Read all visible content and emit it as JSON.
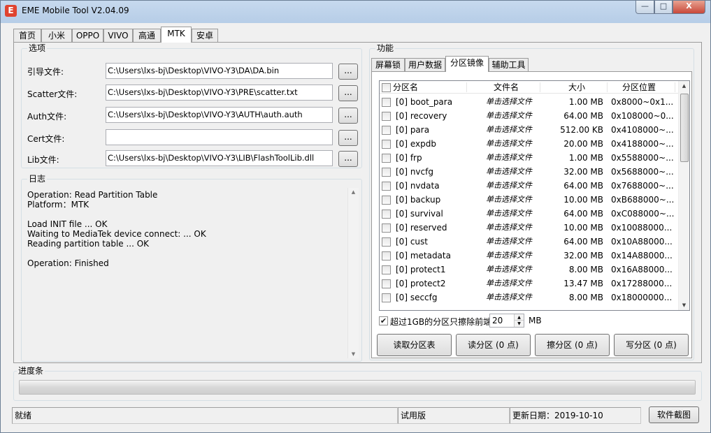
{
  "window": {
    "title": "EME Mobile Tool V2.04.09",
    "icon_glyph": "E",
    "controls": {
      "minimize": "—",
      "maximize": "□",
      "close": "X"
    }
  },
  "main_tabs": [
    "首页",
    "小米",
    "OPPO",
    "VIVO",
    "高通",
    "MTK",
    "安卓"
  ],
  "active_main_tab": "MTK",
  "options": {
    "title": "选项",
    "fields": [
      {
        "label": "引导文件:",
        "value": "C:\\Users\\lxs-bj\\Desktop\\VIVO-Y3\\DA\\DA.bin",
        "button": "..."
      },
      {
        "label": "Scatter文件:",
        "value": "C:\\Users\\lxs-bj\\Desktop\\VIVO-Y3\\PRE\\scatter.txt",
        "button": "..."
      },
      {
        "label": "Auth文件:",
        "value": "C:\\Users\\lxs-bj\\Desktop\\VIVO-Y3\\AUTH\\auth.auth",
        "button": "..."
      },
      {
        "label": "Cert文件:",
        "value": "",
        "button": "..."
      },
      {
        "label": "Lib文件:",
        "value": "C:\\Users\\lxs-bj\\Desktop\\VIVO-Y3\\LIB\\FlashToolLib.dll",
        "button": "..."
      }
    ]
  },
  "log": {
    "title": "日志",
    "lines": [
      "Operation: Read Partition Table",
      "Platform：MTK",
      "",
      "Load INIT file ... OK",
      "Waiting to MediaTek device connect: ... OK",
      "Reading partition table ... OK",
      "",
      "Operation: Finished"
    ]
  },
  "function": {
    "title": "功能",
    "tabs": [
      "屏幕锁",
      "用户数据",
      "分区镜像",
      "辅助工具"
    ],
    "active_tab": "分区镜像",
    "columns": [
      "分区名",
      "文件名",
      "大小",
      "分区位置"
    ],
    "rows": [
      {
        "name": "[0] boot_para",
        "file": "单击选择文件",
        "size": "1.00 MB",
        "location": "0x8000~0x1..."
      },
      {
        "name": "[0] recovery",
        "file": "单击选择文件",
        "size": "64.00 MB",
        "location": "0x108000~0..."
      },
      {
        "name": "[0] para",
        "file": "单击选择文件",
        "size": "512.00 KB",
        "location": "0x4108000~..."
      },
      {
        "name": "[0] expdb",
        "file": "单击选择文件",
        "size": "20.00 MB",
        "location": "0x4188000~..."
      },
      {
        "name": "[0] frp",
        "file": "单击选择文件",
        "size": "1.00 MB",
        "location": "0x5588000~..."
      },
      {
        "name": "[0] nvcfg",
        "file": "单击选择文件",
        "size": "32.00 MB",
        "location": "0x5688000~..."
      },
      {
        "name": "[0] nvdata",
        "file": "单击选择文件",
        "size": "64.00 MB",
        "location": "0x7688000~..."
      },
      {
        "name": "[0] backup",
        "file": "单击选择文件",
        "size": "10.00 MB",
        "location": "0xB688000~..."
      },
      {
        "name": "[0] survival",
        "file": "单击选择文件",
        "size": "64.00 MB",
        "location": "0xC088000~..."
      },
      {
        "name": "[0] reserved",
        "file": "单击选择文件",
        "size": "10.00 MB",
        "location": "0x10088000..."
      },
      {
        "name": "[0] cust",
        "file": "单击选择文件",
        "size": "64.00 MB",
        "location": "0x10A88000..."
      },
      {
        "name": "[0] metadata",
        "file": "单击选择文件",
        "size": "32.00 MB",
        "location": "0x14A88000..."
      },
      {
        "name": "[0] protect1",
        "file": "单击选择文件",
        "size": "8.00 MB",
        "location": "0x16A88000..."
      },
      {
        "name": "[0] protect2",
        "file": "单击选择文件",
        "size": "13.47 MB",
        "location": "0x17288000..."
      },
      {
        "name": "[0] seccfg",
        "file": "单击选择文件",
        "size": "8.00 MB",
        "location": "0x18000000..."
      }
    ],
    "erase_option": {
      "checked": true,
      "label": "超过1GB的分区只擦除前端",
      "value": "20",
      "unit": "MB"
    },
    "buttons": [
      "读取分区表",
      "读分区 (0 点)",
      "擦分区 (0 点)",
      "写分区 (0 点)"
    ]
  },
  "progress": {
    "title": "进度条",
    "value": 0
  },
  "status": {
    "state": "就绪",
    "edition": "试用版",
    "update": "更新日期：2019-10-10",
    "screenshot_button": "软件截图"
  }
}
